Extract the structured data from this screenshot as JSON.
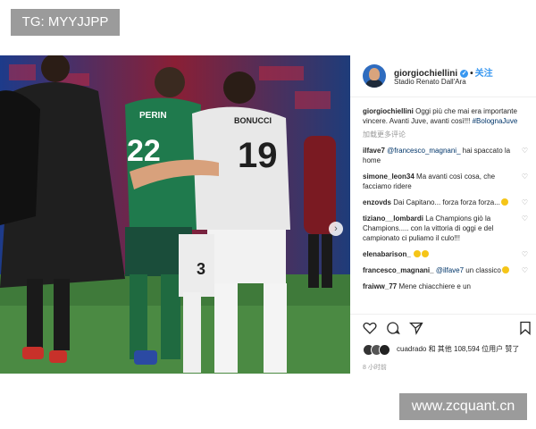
{
  "overlays": {
    "tg_label": "TG: MYYJJPP",
    "watermark": "www.zcquant.cn"
  },
  "photo": {
    "jersey_numbers": [
      "22",
      "19",
      "3"
    ],
    "name_tags": [
      "PERIN",
      "BONUCCI"
    ]
  },
  "header": {
    "username": "giorgiochiellini",
    "separator": "•",
    "follow_label": "关注",
    "location": "Stadio Renato Dall'Ara"
  },
  "caption": {
    "username": "giorgiochiellini",
    "text": "Oggi più che mai era importante vincere. Avanti Juve, avanti così!!!",
    "hashtag": "#BolognaJuve"
  },
  "view_all_label": "加载更多评论",
  "comments": [
    {
      "user": "ilfave7",
      "mention": "@francesco_magnani_",
      "text": " hai spaccato la home"
    },
    {
      "user": "simone_leon34",
      "mention": "",
      "text": "Ma avanti così cosa, che facciamo ridere"
    },
    {
      "user": "enzovds",
      "mention": "",
      "text": "Dai Capitano... forza forza forza..."
    },
    {
      "user": "tiziano__lombardi",
      "mention": "",
      "text": "La Champions giò la Champions..... con la vittoria di oggi e del campionato ci puliamo il culo!!!"
    },
    {
      "user": "elenabarison_",
      "mention": "",
      "text": ""
    },
    {
      "user": "francesco_magnani_",
      "mention": "@ilfave7",
      "text": " un classico"
    },
    {
      "user": "fraiww_77",
      "mention": "",
      "text": "Mene chiacchiere e un"
    }
  ],
  "likes": {
    "text": "cuadrado 和 其他 108,594 位用户 赞了"
  },
  "time_label": "8 小时前",
  "colors": {
    "accent": "#3897f0",
    "badge_gray": "#9b9b9b",
    "muted": "#999999"
  },
  "icons": [
    "verified-icon",
    "heart-icon",
    "comment-icon",
    "share-icon",
    "bookmark-icon",
    "chevron-right-icon"
  ]
}
